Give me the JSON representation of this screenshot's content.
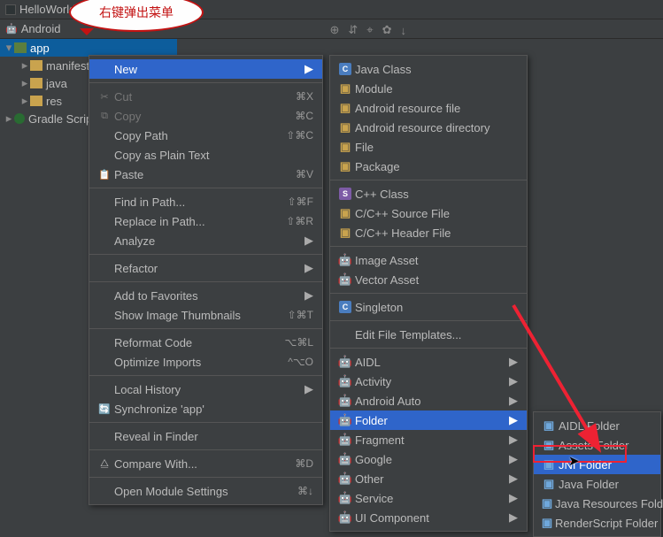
{
  "bubble_text": "右键弹出菜单",
  "titlebar": {
    "project_name": "HelloWorld"
  },
  "breadcrumb": {
    "view_mode": "Android"
  },
  "toolbar_icons": [
    "⊕",
    "⇵",
    "⌖",
    "✿",
    "↓"
  ],
  "tree": {
    "app": "app",
    "manifests": "manifests",
    "java": "java",
    "res": "res",
    "gradle": "Gradle Scripts"
  },
  "menu1": [
    {
      "label": "New",
      "sel": true,
      "arrow": true
    },
    "sep",
    {
      "label": "Cut",
      "sc": "⌘X",
      "disabled": true,
      "icon": "✂"
    },
    {
      "label": "Copy",
      "sc": "⌘C",
      "disabled": true,
      "icon": "⧉"
    },
    {
      "label": "Copy Path",
      "sc": "⇧⌘C"
    },
    {
      "label": "Copy as Plain Text"
    },
    {
      "label": "Paste",
      "sc": "⌘V",
      "icon": "📋"
    },
    "sep",
    {
      "label": "Find in Path...",
      "sc": "⇧⌘F"
    },
    {
      "label": "Replace in Path...",
      "sc": "⇧⌘R"
    },
    {
      "label": "Analyze",
      "arrow": true
    },
    "sep",
    {
      "label": "Refactor",
      "arrow": true
    },
    "sep",
    {
      "label": "Add to Favorites",
      "arrow": true
    },
    {
      "label": "Show Image Thumbnails",
      "sc": "⇧⌘T"
    },
    "sep",
    {
      "label": "Reformat Code",
      "sc": "⌥⌘L"
    },
    {
      "label": "Optimize Imports",
      "sc": "^⌥O"
    },
    "sep",
    {
      "label": "Local History",
      "arrow": true
    },
    {
      "label": "Synchronize 'app'",
      "icon": "🔄"
    },
    "sep",
    {
      "label": "Reveal in Finder"
    },
    "sep",
    {
      "label": "Compare With...",
      "sc": "⌘D",
      "icon": "⧋"
    },
    "sep",
    {
      "label": "Open Module Settings",
      "sc": "⌘↓"
    }
  ],
  "menu2": [
    {
      "label": "Java Class",
      "icon": "c"
    },
    {
      "label": "Module",
      "icon": "f"
    },
    {
      "label": "Android resource file",
      "icon": "f"
    },
    {
      "label": "Android resource directory",
      "icon": "f"
    },
    {
      "label": "File",
      "icon": "f"
    },
    {
      "label": "Package",
      "icon": "f"
    },
    "sep",
    {
      "label": "C++ Class",
      "icon": "s"
    },
    {
      "label": "C/C++ Source File",
      "icon": "f"
    },
    {
      "label": "C/C++ Header File",
      "icon": "f"
    },
    "sep",
    {
      "label": "Image Asset",
      "icon": "a"
    },
    {
      "label": "Vector Asset",
      "icon": "a"
    },
    "sep",
    {
      "label": "Singleton",
      "icon": "c"
    },
    "sep",
    {
      "label": "Edit File Templates..."
    },
    "sep",
    {
      "label": "AIDL",
      "icon": "a",
      "arrow": true
    },
    {
      "label": "Activity",
      "icon": "a",
      "arrow": true
    },
    {
      "label": "Android Auto",
      "icon": "a",
      "arrow": true
    },
    {
      "label": "Folder",
      "icon": "a",
      "arrow": true,
      "sel": true
    },
    {
      "label": "Fragment",
      "icon": "a",
      "arrow": true
    },
    {
      "label": "Google",
      "icon": "a",
      "arrow": true
    },
    {
      "label": "Other",
      "icon": "a",
      "arrow": true
    },
    {
      "label": "Service",
      "icon": "a",
      "arrow": true
    },
    {
      "label": "UI Component",
      "icon": "a",
      "arrow": true
    }
  ],
  "menu3": [
    {
      "label": "AIDL Folder",
      "icon": "fo"
    },
    {
      "label": "Assets Folder",
      "icon": "fo"
    },
    {
      "label": "JNI Folder",
      "icon": "fo",
      "sel": true
    },
    {
      "label": "Java Folder",
      "icon": "fo"
    },
    {
      "label": "Java Resources Folder",
      "icon": "fo"
    },
    {
      "label": "RenderScript Folder",
      "icon": "fo"
    }
  ]
}
